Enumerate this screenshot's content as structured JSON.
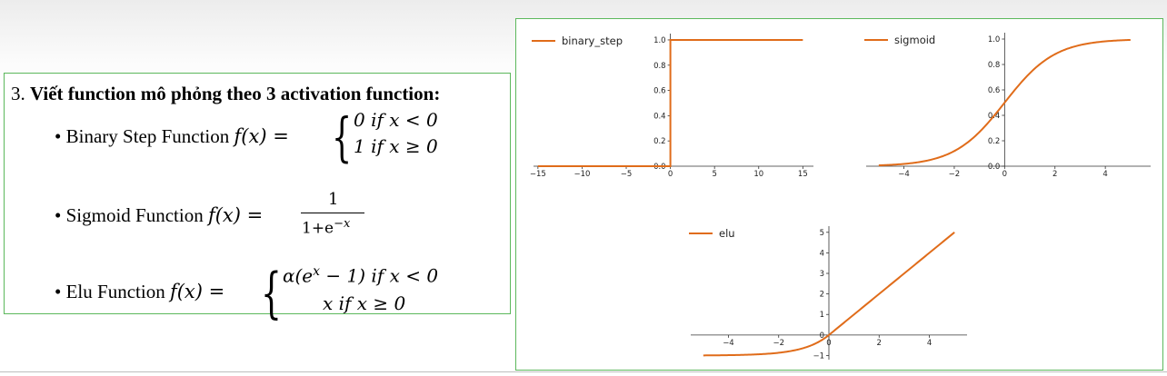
{
  "slide": {
    "heading_number": "3.",
    "heading_text": "Viết function mô phỏng theo 3 activation function:",
    "bullets": [
      {
        "name": "Binary Step Function",
        "lhs": "f(x) =",
        "cases": [
          "0 if x < 0",
          "1 if x ≥ 0"
        ]
      },
      {
        "name": "Sigmoid Function",
        "lhs": "f(x) =",
        "numerator": "1",
        "denominator": "1+e",
        "exponent": "−x"
      },
      {
        "name": "Elu Function",
        "lhs": "f(x) =",
        "cases": [
          "α(e",
          "x",
          " − 1) if x < 0",
          "x if x ≥ 0"
        ]
      }
    ]
  },
  "colors": {
    "line": "#e06c1a",
    "border": "#5cb85c",
    "axis": "#333333"
  },
  "chart_data": [
    {
      "type": "line",
      "legend": "binary_step",
      "legend_position": "top-left",
      "x": [
        -15,
        0,
        0,
        15
      ],
      "y": [
        0,
        0,
        1,
        1
      ],
      "xlim": [
        -15.5,
        16.2
      ],
      "ylim": [
        0,
        1.05
      ],
      "xticks": [
        -15,
        -10,
        -5,
        0,
        5,
        10,
        15
      ],
      "xtick_labels": [
        "−15",
        "−10",
        "−5",
        "0",
        "5",
        "10",
        "15"
      ],
      "yticks": [
        0.0,
        0.2,
        0.4,
        0.6,
        0.8,
        1.0
      ],
      "ytick_labels": [
        "0.0",
        "0.2",
        "0.4",
        "0.6",
        "0.8",
        "1.0"
      ],
      "spines": "centered",
      "grid": false
    },
    {
      "type": "line",
      "legend": "sigmoid",
      "legend_position": "top-left",
      "function": "sigmoid",
      "x_range": [
        -5,
        5
      ],
      "xlim": [
        -5.5,
        5.8
      ],
      "ylim": [
        0,
        1.05
      ],
      "xticks": [
        -4,
        -2,
        0,
        2,
        4
      ],
      "xtick_labels": [
        "−4",
        "−2",
        "0",
        "2",
        "4"
      ],
      "yticks": [
        0.0,
        0.2,
        0.4,
        0.6,
        0.8,
        1.0
      ],
      "ytick_labels": [
        "0.0",
        "0.2",
        "0.4",
        "0.6",
        "0.8",
        "1.0"
      ],
      "spines": "centered",
      "grid": false
    },
    {
      "type": "line",
      "legend": "elu",
      "legend_position": "top-left",
      "function": "elu",
      "alpha": 1,
      "x_range": [
        -5,
        5
      ],
      "xlim": [
        -5.5,
        5.5
      ],
      "ylim": [
        -1.2,
        5.3
      ],
      "xticks": [
        -4,
        -2,
        0,
        2,
        4
      ],
      "xtick_labels": [
        "−4",
        "−2",
        "0",
        "2",
        "4"
      ],
      "yticks": [
        -1,
        0,
        1,
        2,
        3,
        4,
        5
      ],
      "ytick_labels": [
        "−1",
        "0",
        "1",
        "2",
        "3",
        "4",
        "5"
      ],
      "spines": "centered",
      "grid": false
    }
  ]
}
